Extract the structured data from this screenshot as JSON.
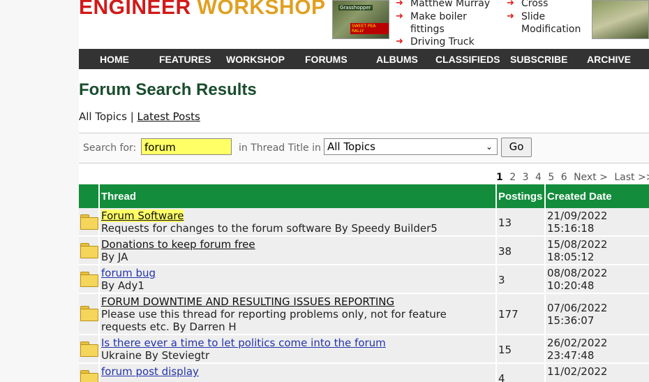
{
  "header": {
    "logo_part1": "ENGINEER",
    "logo_part2": "WORKSHOP",
    "mag1_tag1": "Grasshopper",
    "mag1_tag2": "SWEET PEA RALLY",
    "headlines_left": [
      "Matthew Murray",
      "Make boiler fittings",
      "Driving Truck"
    ],
    "headlines_right": [
      "Cross",
      "Slide Modification"
    ]
  },
  "nav": [
    "HOME",
    "FEATURES",
    "WORKSHOP",
    "FORUMS",
    "ALBUMS",
    "CLASSIFIEDS",
    "SUBSCRIBE",
    "ARCHIVE"
  ],
  "page_title": "Forum Search Results",
  "topics": {
    "all": "All Topics",
    "separator": "|",
    "latest": "Latest Posts"
  },
  "search": {
    "label": "Search for:",
    "value": "forum",
    "scope_label": "in Thread Title in",
    "selected": "All Topics",
    "go": "Go"
  },
  "pager": {
    "pages": [
      "1",
      "2",
      "3",
      "4",
      "5",
      "6"
    ],
    "next": "Next >",
    "last": "Last >>"
  },
  "table": {
    "headers": {
      "thread": "Thread",
      "postings": "Postings",
      "created": "Created Date"
    },
    "rows": [
      {
        "title": "Forum Software",
        "desc": "Requests for changes to the forum software By Speedy Builder5",
        "postings": "13",
        "date": "21/09/2022",
        "time": "15:16:18"
      },
      {
        "title": "Donations to keep forum free",
        "desc": "By JA",
        "postings": "38",
        "date": "15/08/2022",
        "time": "18:05:12"
      },
      {
        "title": "forum bug",
        "desc": "By Ady1",
        "postings": "3",
        "date": "08/08/2022",
        "time": "10:20:48"
      },
      {
        "title": "FORUM DOWNTIME AND RESULTING ISSUES REPORTING",
        "desc": "Please use this thread for reporting problems only, not for feature requests etc. By Darren H",
        "postings": "177",
        "date": "07/06/2022",
        "time": "15:36:07"
      },
      {
        "title": "Is there ever a time to let politics come into the forum",
        "desc": "Ukraine By Steviegtr",
        "postings": "15",
        "date": "26/02/2022",
        "time": "23:47:48"
      },
      {
        "title": "forum post display",
        "desc": "",
        "postings": "4",
        "date": "11/02/2022",
        "time": ""
      }
    ]
  }
}
